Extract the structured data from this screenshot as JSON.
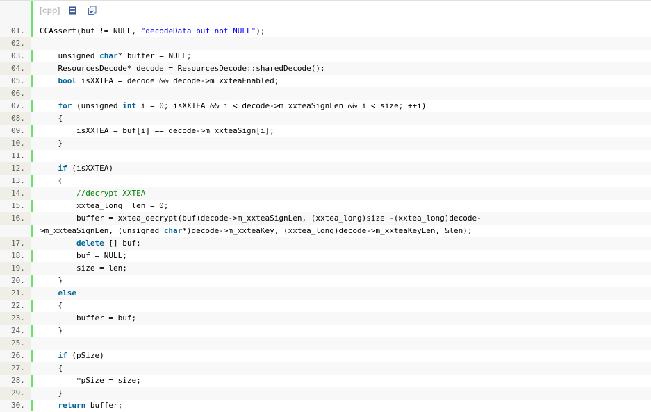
{
  "toolbar": {
    "language": "[cpp]",
    "icons": [
      "view-source-icon",
      "copy-icon"
    ]
  },
  "lines": [
    {
      "n": "01.",
      "tokens": [
        [
          "p",
          "CCAssert(buf != NULL, "
        ],
        [
          "s",
          "\"decodeData buf not NULL\""
        ],
        [
          "p",
          ");"
        ]
      ]
    },
    {
      "n": "02.",
      "tokens": []
    },
    {
      "n": "03.",
      "tokens": [
        [
          "p",
          "    unsigned "
        ],
        [
          "k",
          "char"
        ],
        [
          "p",
          "* buffer = NULL;"
        ]
      ]
    },
    {
      "n": "04.",
      "tokens": [
        [
          "p",
          "    ResourcesDecode* decode = ResourcesDecode::sharedDecode();"
        ]
      ]
    },
    {
      "n": "05.",
      "tokens": [
        [
          "p",
          "    "
        ],
        [
          "k",
          "bool"
        ],
        [
          "p",
          " isXXTEA = decode && decode->m_xxteaEnabled;"
        ]
      ]
    },
    {
      "n": "06.",
      "tokens": []
    },
    {
      "n": "07.",
      "tokens": [
        [
          "p",
          "    "
        ],
        [
          "k",
          "for"
        ],
        [
          "p",
          " (unsigned "
        ],
        [
          "k",
          "int"
        ],
        [
          "p",
          " i = 0; isXXTEA && i < decode->m_xxteaSignLen && i < size; ++i)"
        ]
      ]
    },
    {
      "n": "08.",
      "tokens": [
        [
          "p",
          "    {"
        ]
      ]
    },
    {
      "n": "09.",
      "tokens": [
        [
          "p",
          "        isXXTEA = buf[i] == decode->m_xxteaSign[i];"
        ]
      ]
    },
    {
      "n": "10.",
      "tokens": [
        [
          "p",
          "    }"
        ]
      ]
    },
    {
      "n": "11.",
      "tokens": []
    },
    {
      "n": "12.",
      "tokens": [
        [
          "p",
          "    "
        ],
        [
          "k",
          "if"
        ],
        [
          "p",
          " (isXXTEA)"
        ]
      ]
    },
    {
      "n": "13.",
      "tokens": [
        [
          "p",
          "    {"
        ]
      ]
    },
    {
      "n": "14.",
      "tokens": [
        [
          "p",
          "        "
        ],
        [
          "c",
          "//decrypt XXTEA"
        ]
      ]
    },
    {
      "n": "15.",
      "tokens": [
        [
          "p",
          "        xxtea_long  len = 0;"
        ]
      ]
    },
    {
      "n": "16.",
      "tokens": [
        [
          "p",
          "        buffer = xxtea_decrypt(buf+decode->m_xxteaSignLen, (xxtea_long)size -(xxtea_long)decode-"
        ]
      ]
    },
    {
      "n": "",
      "cont": true,
      "tokens": [
        [
          "p",
          ">m_xxteaSignLen, (unsigned "
        ],
        [
          "k",
          "char"
        ],
        [
          "p",
          "*)decode->m_xxteaKey, (xxtea_long)decode->m_xxteaKeyLen, &len);"
        ]
      ]
    },
    {
      "n": "17.",
      "tokens": [
        [
          "p",
          "        "
        ],
        [
          "k",
          "delete"
        ],
        [
          "p",
          " [] buf;"
        ]
      ]
    },
    {
      "n": "18.",
      "tokens": [
        [
          "p",
          "        buf = NULL;"
        ]
      ]
    },
    {
      "n": "19.",
      "tokens": [
        [
          "p",
          "        size = len;"
        ]
      ]
    },
    {
      "n": "20.",
      "tokens": [
        [
          "p",
          "    }"
        ]
      ]
    },
    {
      "n": "21.",
      "tokens": [
        [
          "p",
          "    "
        ],
        [
          "k",
          "else"
        ]
      ]
    },
    {
      "n": "22.",
      "tokens": [
        [
          "p",
          "    {"
        ]
      ]
    },
    {
      "n": "23.",
      "tokens": [
        [
          "p",
          "        buffer = buf;"
        ]
      ]
    },
    {
      "n": "24.",
      "tokens": [
        [
          "p",
          "    }"
        ]
      ]
    },
    {
      "n": "25.",
      "tokens": []
    },
    {
      "n": "26.",
      "tokens": [
        [
          "p",
          "    "
        ],
        [
          "k",
          "if"
        ],
        [
          "p",
          " (pSize)"
        ]
      ]
    },
    {
      "n": "27.",
      "tokens": [
        [
          "p",
          "    {"
        ]
      ]
    },
    {
      "n": "28.",
      "tokens": [
        [
          "p",
          "        *pSize = size;"
        ]
      ]
    },
    {
      "n": "29.",
      "tokens": [
        [
          "p",
          "    }"
        ]
      ]
    },
    {
      "n": "30.",
      "tokens": [
        [
          "p",
          "    "
        ],
        [
          "k",
          "return"
        ],
        [
          "p",
          " buffer;"
        ]
      ]
    }
  ],
  "colors": {
    "keyword": "#006699",
    "string": "#0000ff",
    "comment": "#008200",
    "gutter_bar": "#6ce26c"
  }
}
